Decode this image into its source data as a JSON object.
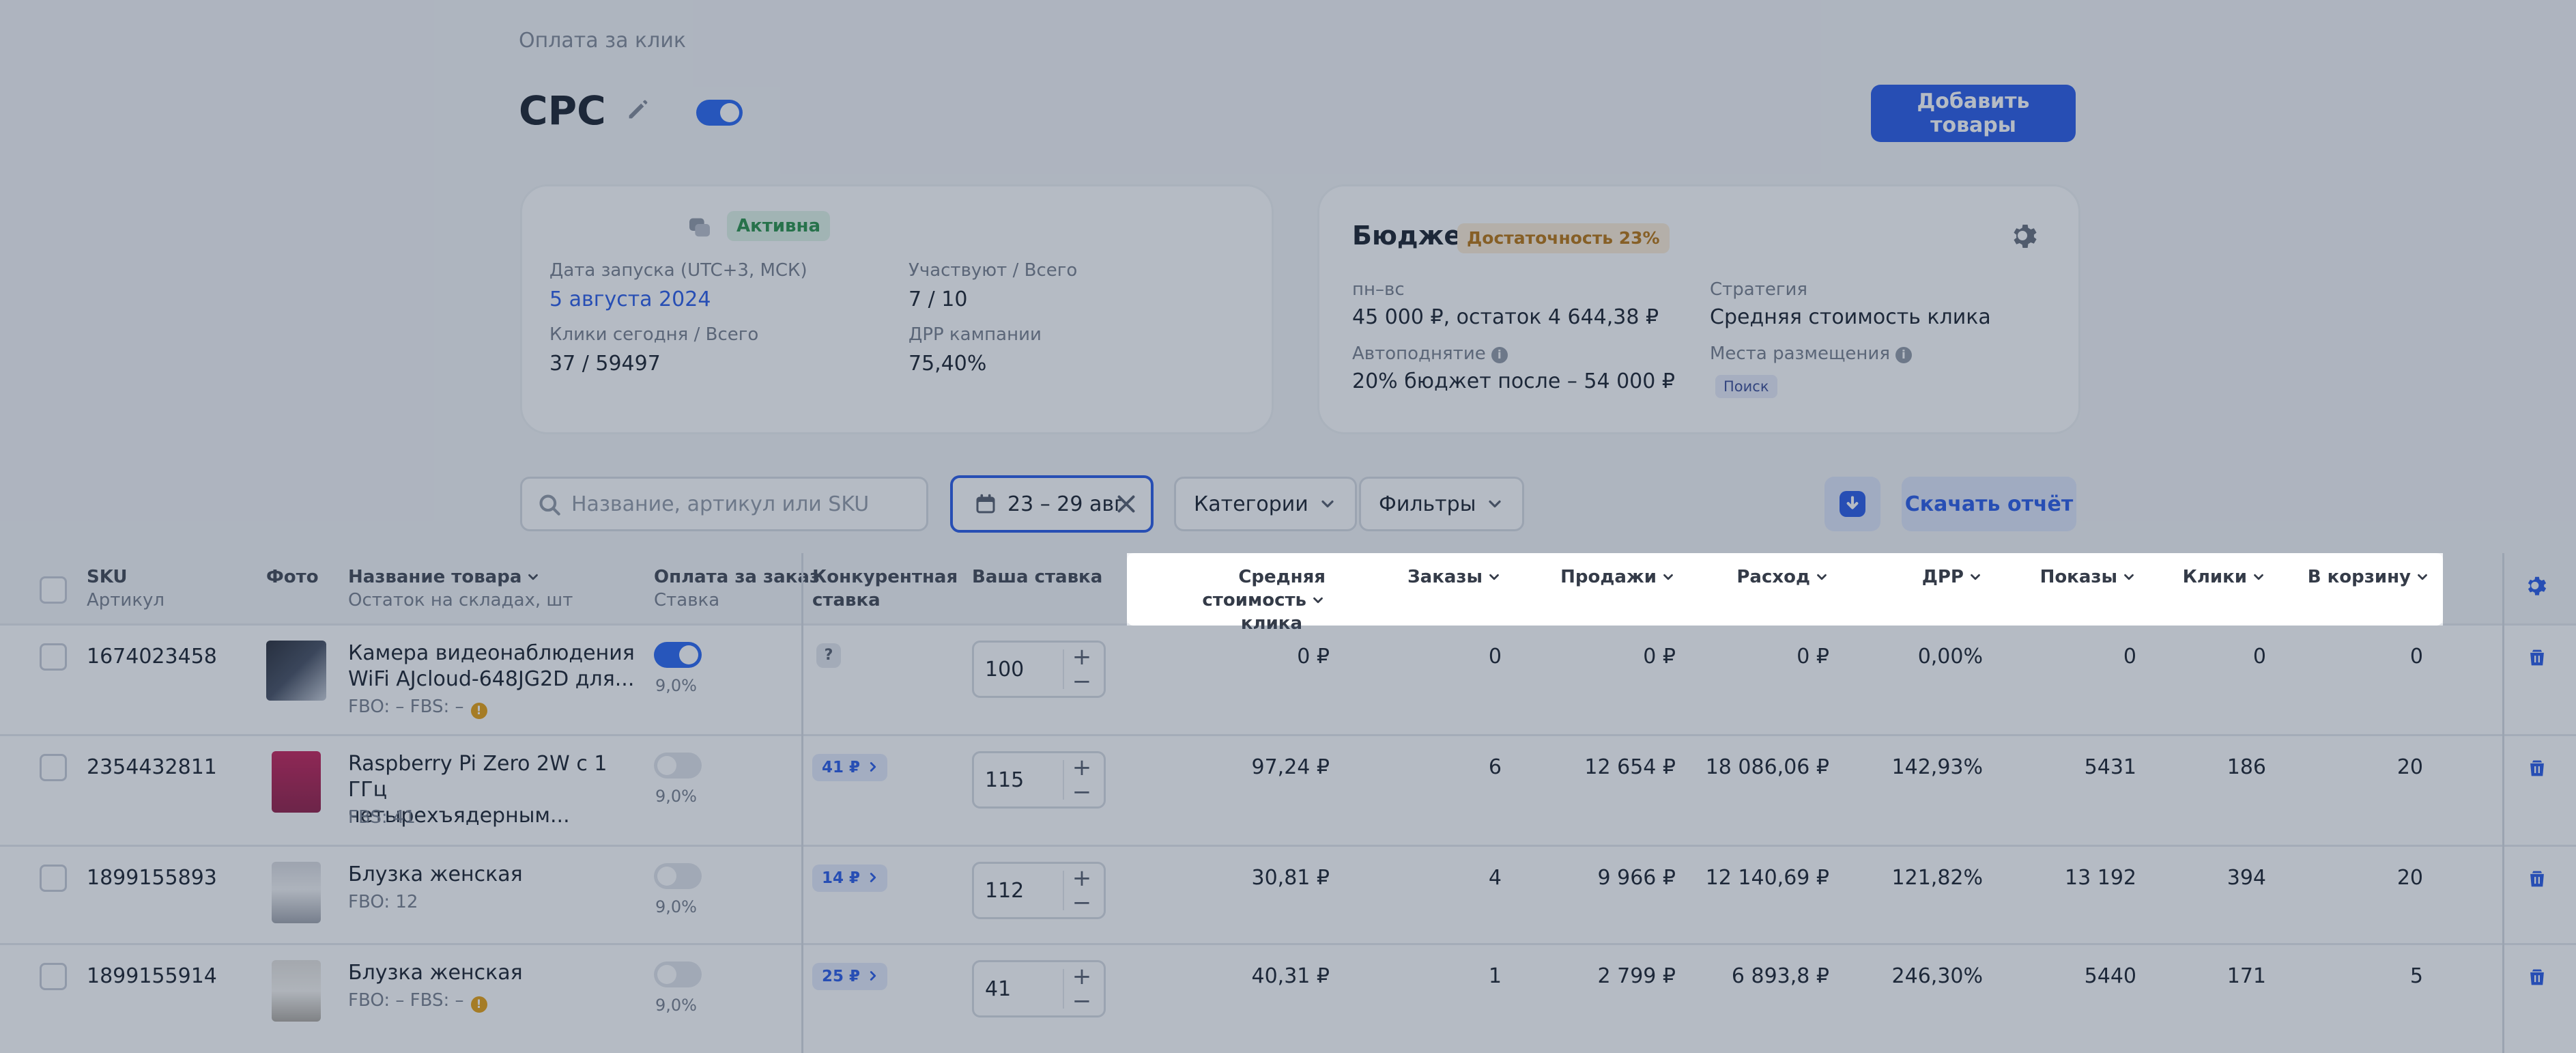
{
  "breadcrumb": "Оплата за клик",
  "title": "CPC",
  "add_button": "Добавить товары",
  "campaign_card": {
    "status": "Активна",
    "launch_label": "Дата запуска (UTC+3, МСК)",
    "launch_value": "5 августа 2024",
    "participate_label": "Участвуют / Всего",
    "participate_value": "7 / 10",
    "clicks_label": "Клики сегодня / Всего",
    "clicks_value": "37 / 59497",
    "drr_label": "ДРР кампании",
    "drr_value": "75,40%"
  },
  "budget_card": {
    "title": "Бюджет",
    "sufficiency": "Достаточность 23%",
    "period_label": "пн–вс",
    "period_value": "45 000 ₽, остаток 4 644,38 ₽",
    "autoraise_label": "Автоподнятие",
    "autoraise_value": "20% бюджет после – 54 000 ₽",
    "strategy_label": "Стратегия",
    "strategy_value": "Средняя стоимость клика",
    "placement_label": "Места размещения",
    "placement_chip": "Поиск"
  },
  "toolbar": {
    "search_placeholder": "Название, артикул или SKU",
    "date_range": "23 – 29 авг",
    "categories": "Категории",
    "filters": "Фильтры",
    "report": "Скачать отчёт"
  },
  "table": {
    "headers": {
      "sku": "SKU",
      "sku_sub": "Артикул",
      "photo": "Фото",
      "name": "Название товара",
      "name_sub": "Остаток на складах, шт",
      "pay": "Оплата за заказ",
      "pay_sub": "Ставка",
      "competitive": "Конкурентная",
      "competitive_2": "ставка",
      "bid": "Ваша ставка",
      "avg_cost": "Средняя стоимость",
      "avg_cost_2": "клика",
      "orders": "Заказы",
      "sales": "Продажи",
      "spend": "Расход",
      "drr": "ДРР",
      "impressions": "Показы",
      "clicks": "Клики",
      "cart": "В корзину"
    },
    "rows": [
      {
        "sku": "1674023458",
        "name_1": "Камера видеонаблюдения",
        "name_2": "WiFi AJcloud-648JG2D для...",
        "stock": "FBO: –   FBS: –",
        "pay_on": true,
        "rate": "9,0%",
        "competitive": "",
        "bid": "100",
        "avg_cost": "0 ₽",
        "orders": "0",
        "sales": "0 ₽",
        "spend": "0 ₽",
        "drr": "0,00%",
        "impressions": "0",
        "clicks": "0",
        "cart": "0"
      },
      {
        "sku": "2354432811",
        "name_1": "Raspberry Pi Zero 2W с 1 ГГц",
        "name_2": "четырехъядерным...",
        "stock": "FBS: 41",
        "pay_on": false,
        "rate": "9,0%",
        "competitive": "41 ₽",
        "bid": "115",
        "avg_cost": "97,24 ₽",
        "orders": "6",
        "sales": "12 654 ₽",
        "spend": "18 086,06 ₽",
        "drr": "142,93%",
        "impressions": "5431",
        "clicks": "186",
        "cart": "20"
      },
      {
        "sku": "1899155893",
        "name_1": "Блузка женская",
        "name_2": "",
        "stock": "FBO: 12",
        "pay_on": false,
        "rate": "9,0%",
        "competitive": "14 ₽",
        "bid": "112",
        "avg_cost": "30,81 ₽",
        "orders": "4",
        "sales": "9 966 ₽",
        "spend": "12 140,69 ₽",
        "drr": "121,82%",
        "impressions": "13 192",
        "clicks": "394",
        "cart": "20"
      },
      {
        "sku": "1899155914",
        "name_1": "Блузка женская",
        "name_2": "",
        "stock": "FBO: –   FBS: –",
        "pay_on": false,
        "rate": "9,0%",
        "competitive": "25 ₽",
        "bid": "41",
        "avg_cost": "40,31 ₽",
        "orders": "1",
        "sales": "2 799 ₽",
        "spend": "6 893,8 ₽",
        "drr": "246,30%",
        "impressions": "5440",
        "clicks": "171",
        "cart": "5"
      }
    ]
  }
}
